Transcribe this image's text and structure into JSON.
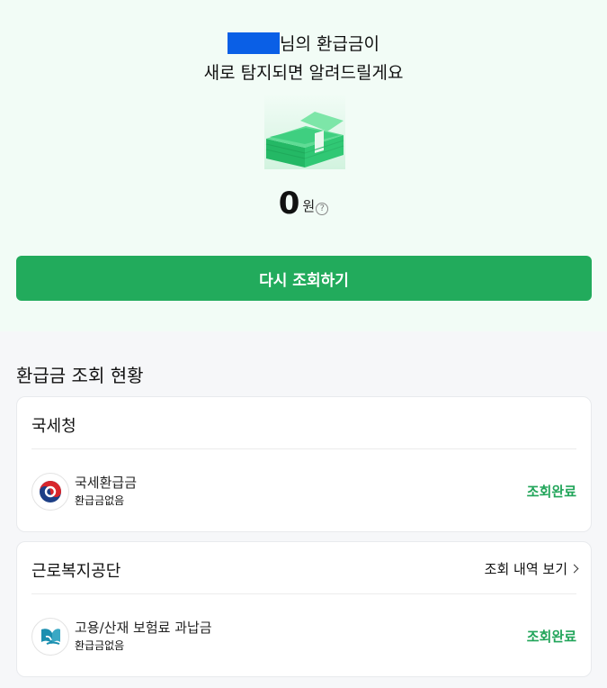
{
  "hero": {
    "headline_suffix": "님의 환급금이",
    "headline_line2": "새로 탐지되면 알려드릴게요",
    "amount": "0",
    "unit": "원",
    "help_glyph": "?",
    "retry_button": "다시 조회하기"
  },
  "status_section": {
    "title": "환급금 조회 현황"
  },
  "cards": [
    {
      "title": "국세청",
      "item_title": "국세환급금",
      "item_sub": "환급금없음",
      "status": "조회완료",
      "logo_icon": "taegeuk-logo-icon"
    },
    {
      "title": "근로복지공단",
      "link": "조회 내역 보기",
      "item_title": "고용/산재 보험료 과납금",
      "item_sub": "환급금없음",
      "status": "조회완료",
      "logo_icon": "comwel-logo-icon"
    }
  ],
  "colors": {
    "brand_green": "#22ab5c",
    "status_green": "#22a55a",
    "hero_bg": "#f2fcf6",
    "name_mask": "#0a5fe6"
  }
}
